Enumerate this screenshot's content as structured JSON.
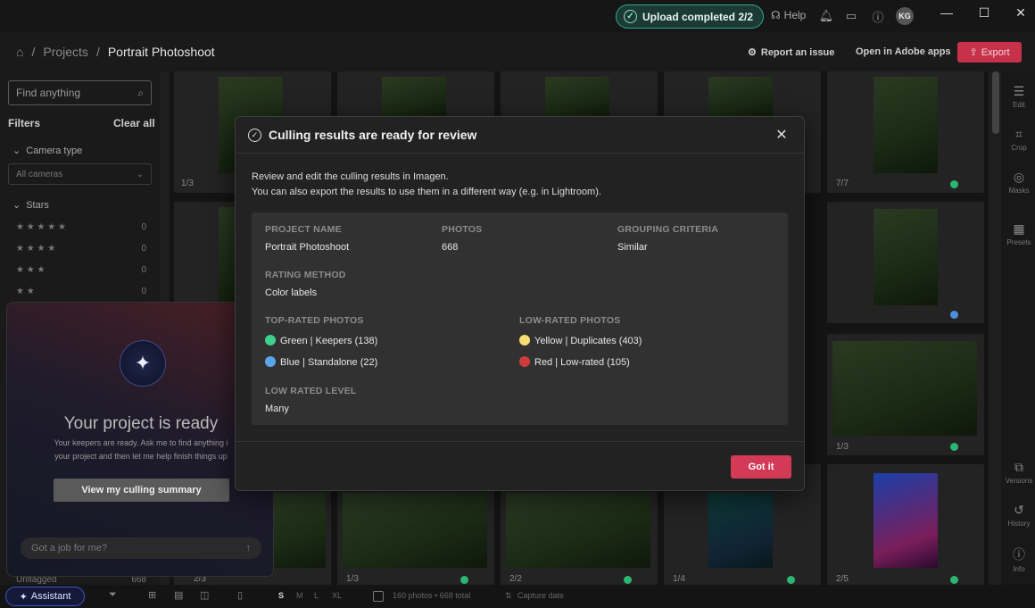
{
  "topbar": {
    "upload_status": "Upload completed 2/2",
    "help_label": "Help",
    "user_initials": "KG",
    "window_controls": [
      "—",
      "☐",
      "✕"
    ]
  },
  "breadcrumb": {
    "home_icon": "home-icon",
    "separator": "/",
    "project_root": "Projects",
    "current": "Portrait Photoshoot"
  },
  "header": {
    "report_issue": "Report an issue",
    "open_adobe": "Open in Adobe apps",
    "export": "Export"
  },
  "sidebar": {
    "search_placeholder": "Find anything",
    "filters_label": "Filters",
    "clear_all": "Clear all",
    "camera_section": "Camera type",
    "camera_value": "All cameras",
    "stars_section": "Stars",
    "stars": [
      {
        "stars": "★ ★ ★ ★ ★",
        "count": "0"
      },
      {
        "stars": "★ ★ ★ ★",
        "count": "0"
      },
      {
        "stars": "★ ★ ★",
        "count": "0"
      },
      {
        "stars": "★ ★",
        "count": "0"
      }
    ],
    "bottom_item": "Unflagged",
    "bottom_count": "668"
  },
  "grid": {
    "counts": [
      "1/3",
      "7/7",
      "1/3",
      "2/3",
      "1/3",
      "2/2",
      "1/4",
      "2/5"
    ],
    "colors": {
      "green": "#2bb673",
      "blue": "#4a90d9",
      "yellow": "#f2d45c",
      "red": "#d13b3b"
    }
  },
  "right_tools": [
    "Edit",
    "Crop",
    "Masks",
    "Presets",
    "Versions",
    "History",
    "Info"
  ],
  "assistant_panel": {
    "title": "Your project is ready",
    "line1": "Your keepers are ready. Ask me to find anything i",
    "line2": "your project and then let me help finish things up",
    "button": "View my culling summary",
    "input_placeholder": "Got a job for me?"
  },
  "bottombar": {
    "assistant": "Assistant",
    "sizes": [
      "S",
      "M",
      "L",
      "XL"
    ],
    "photo_count": "160 photos • 668 total",
    "sort": "Capture date"
  },
  "modal": {
    "title": "Culling results are ready for review",
    "intro1": "Review and edit the culling results in Imagen.",
    "intro2": "You can also export the results to use them in a different way (e.g. in Lightroom).",
    "project_name_label": "PROJECT NAME",
    "project_name": "Portrait Photoshoot",
    "photos_label": "PHOTOS",
    "photos": "668",
    "grouping_label": "GROUPING CRITERIA",
    "grouping": "Similar",
    "rating_label": "RATING METHOD",
    "rating": "Color labels",
    "top_rated_label": "TOP-RATED PHOTOS",
    "top_rated": [
      {
        "text": "Green | Keepers (138)",
        "color": "#3ed08a"
      },
      {
        "text": "Blue | Standalone (22)",
        "color": "#5aa6e8"
      }
    ],
    "low_rated_label": "LOW-RATED PHOTOS",
    "low_rated": [
      {
        "text": "Yellow | Duplicates (403)",
        "color": "#f6dd73"
      },
      {
        "text": "Red | Low-rated (105)",
        "color": "#d13b3b"
      }
    ],
    "low_level_label": "LOW RATED LEVEL",
    "low_level": "Many",
    "button": "Got it"
  }
}
